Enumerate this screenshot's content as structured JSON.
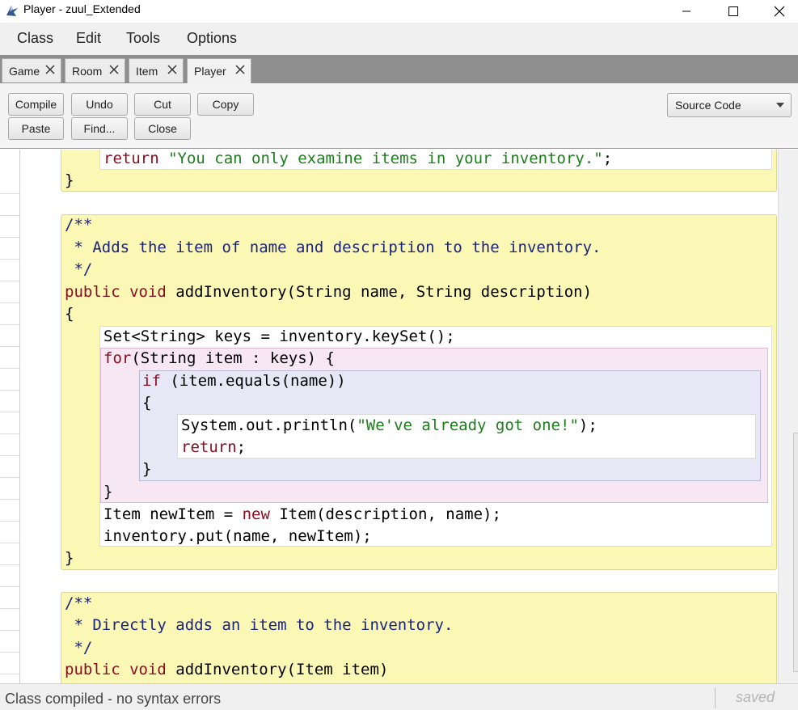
{
  "window": {
    "title": "Player - zuul_Extended",
    "controls": {
      "minimize": "minimize-icon",
      "maximize": "maximize-icon",
      "close": "close-icon"
    }
  },
  "menu": {
    "items": [
      "Class",
      "Edit",
      "Tools",
      "Options"
    ]
  },
  "tabs": [
    {
      "label": "Game"
    },
    {
      "label": "Room"
    },
    {
      "label": "Item"
    },
    {
      "label": "Player",
      "active": true
    }
  ],
  "toolbar": {
    "compile": "Compile",
    "undo": "Undo",
    "cut": "Cut",
    "copy": "Copy",
    "paste": "Paste",
    "find": "Find...",
    "close": "Close",
    "view_mode": "Source Code"
  },
  "code": {
    "line_return_inventory": {
      "kw": "return",
      "str": "\"You can only examine items in your inventory.\"",
      "tail": ";"
    },
    "close_brace": "}",
    "open_brace": "{",
    "doc1": {
      "open": "/**",
      "text": " * Adds the item of name and description to the inventory.",
      "close": " */"
    },
    "sig1": {
      "kw": "public void",
      "rest": " addInventory(String name, String description)"
    },
    "keys_line": "Set<String> keys = inventory.keySet();",
    "for_line": {
      "kw": "for",
      "rest": "(String item : keys) {"
    },
    "if_line": {
      "kw": "if",
      "rest": " (item.equals(name))"
    },
    "println": {
      "pre": "System.out.println(",
      "str": "\"We've already got one!\"",
      "post": ");"
    },
    "return_line": {
      "kw": "return",
      "tail": ";"
    },
    "newitem": {
      "pre": "Item newItem = ",
      "kw": "new",
      "post": " Item(description, name);"
    },
    "put_line": "inventory.put(name, newItem);",
    "doc2": {
      "open": "/**",
      "text": " * Directly adds an item to the inventory.",
      "close": " */"
    },
    "sig2": {
      "kw": "public void",
      "rest": " addInventory(Item item)"
    }
  },
  "status": {
    "message": "Class compiled - no syntax errors",
    "saved": "saved"
  },
  "colors": {
    "keyword": "#8b0d22",
    "comment": "#1a237e",
    "string": "#1d7d1d",
    "class_scope": "#fbf7b5",
    "for_scope": "#f6e7f3",
    "if_scope": "#e8e7f5"
  }
}
